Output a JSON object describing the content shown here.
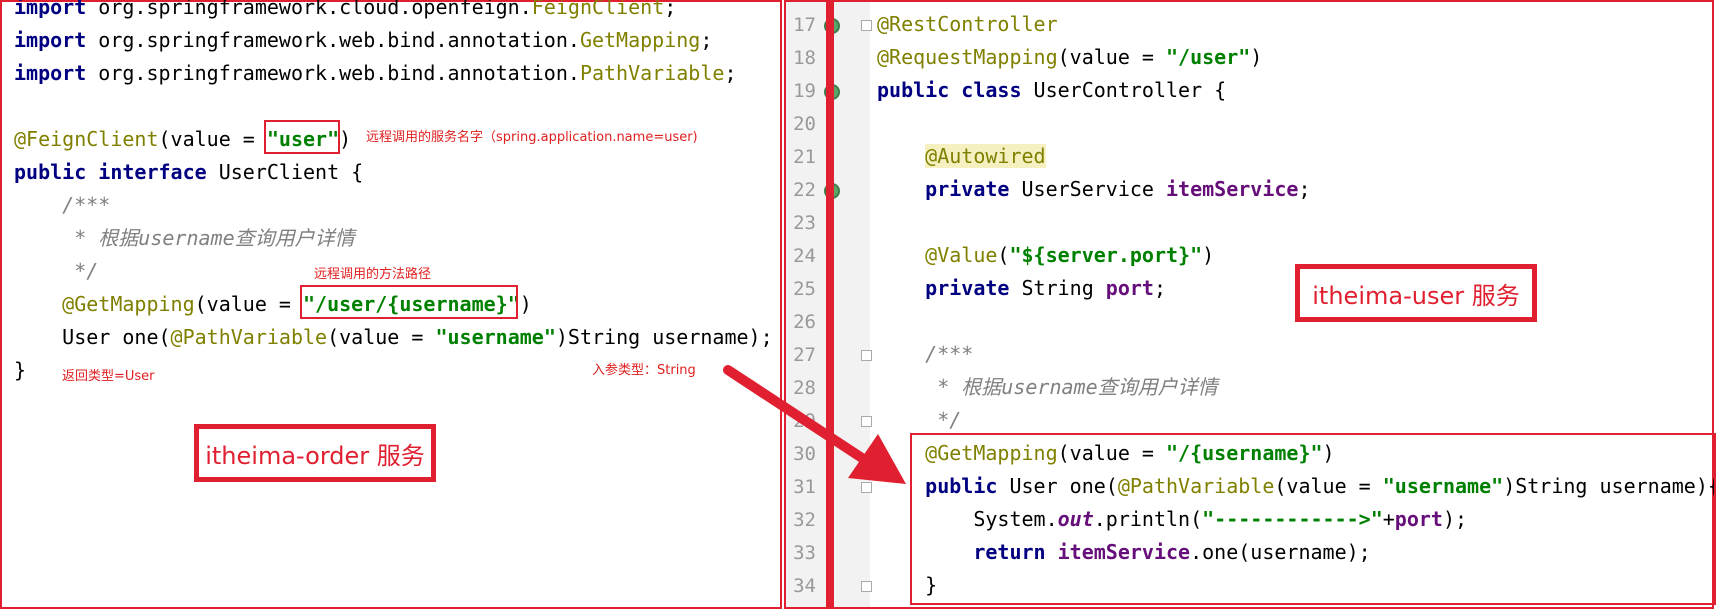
{
  "left_panel": {
    "code_lines": [
      "import org.springframework.cloud.openfeign.FeignClient;",
      "import org.springframework.web.bind.annotation.GetMapping;",
      "import org.springframework.web.bind.annotation.PathVariable;"
    ],
    "annotations": {
      "feign_value": "\"user\"",
      "method_path": "\"/user/{username}\""
    },
    "notes": {
      "service_name": "远程调用的服务名字（spring.application.name=user)",
      "method_path": "远程调用的方法路径",
      "return_type": "返回类型=User",
      "param_type": "入参类型：String"
    },
    "service_label": "itheima-order  服务"
  },
  "right_panel": {
    "line_numbers": [
      "17",
      "18",
      "19",
      "20",
      "21",
      "22",
      "23",
      "24",
      "25",
      "26",
      "27",
      "28",
      "29",
      "30",
      "31",
      "32",
      "33",
      "34"
    ],
    "service_label": "itheima-user  服务"
  },
  "colors": {
    "accent_red": "#e02030",
    "keyword": "#000080",
    "string": "#008000",
    "annotation": "#808000",
    "comment": "#808080",
    "field": "#660e7a"
  }
}
